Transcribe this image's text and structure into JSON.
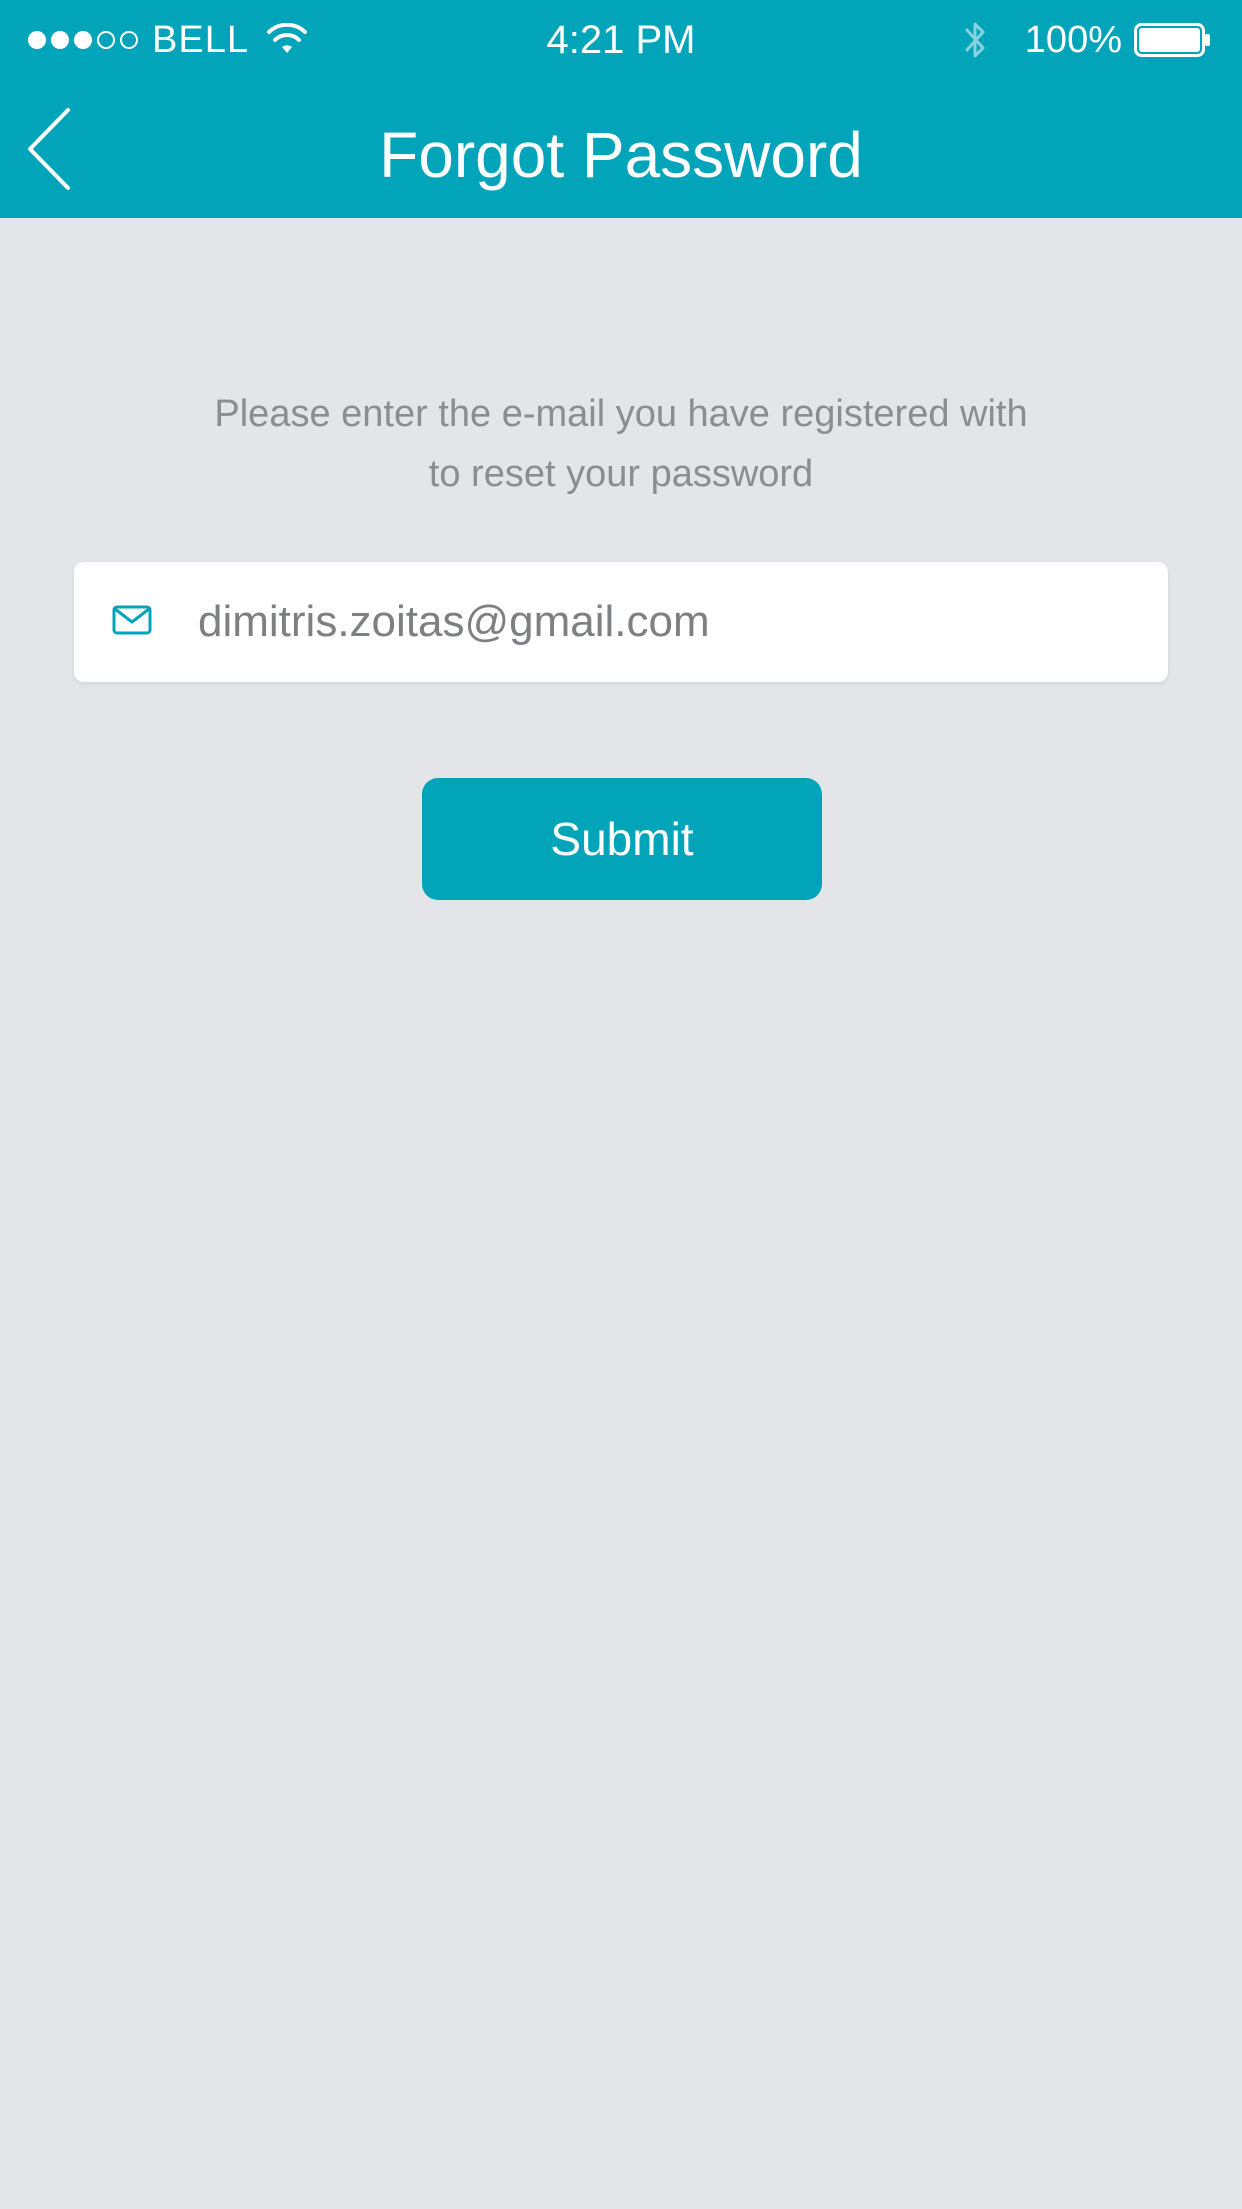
{
  "status_bar": {
    "carrier": "BELL",
    "time": "4:21 PM",
    "battery": "100%",
    "signal_bars_filled": 3,
    "signal_bars_total": 5
  },
  "nav": {
    "title": "Forgot Password",
    "back_icon": "chevron-left-icon"
  },
  "form": {
    "instructions_line1": "Please enter the e-mail you have registered with",
    "instructions_line2": "to reset your password",
    "email_icon": "mail-icon",
    "email_value": "dimitris.zoitas@gmail.com",
    "submit_label": "Submit"
  },
  "colors": {
    "accent": "#02a4b9",
    "background": "#e4e5e9",
    "text_muted": "#8b8d91"
  }
}
